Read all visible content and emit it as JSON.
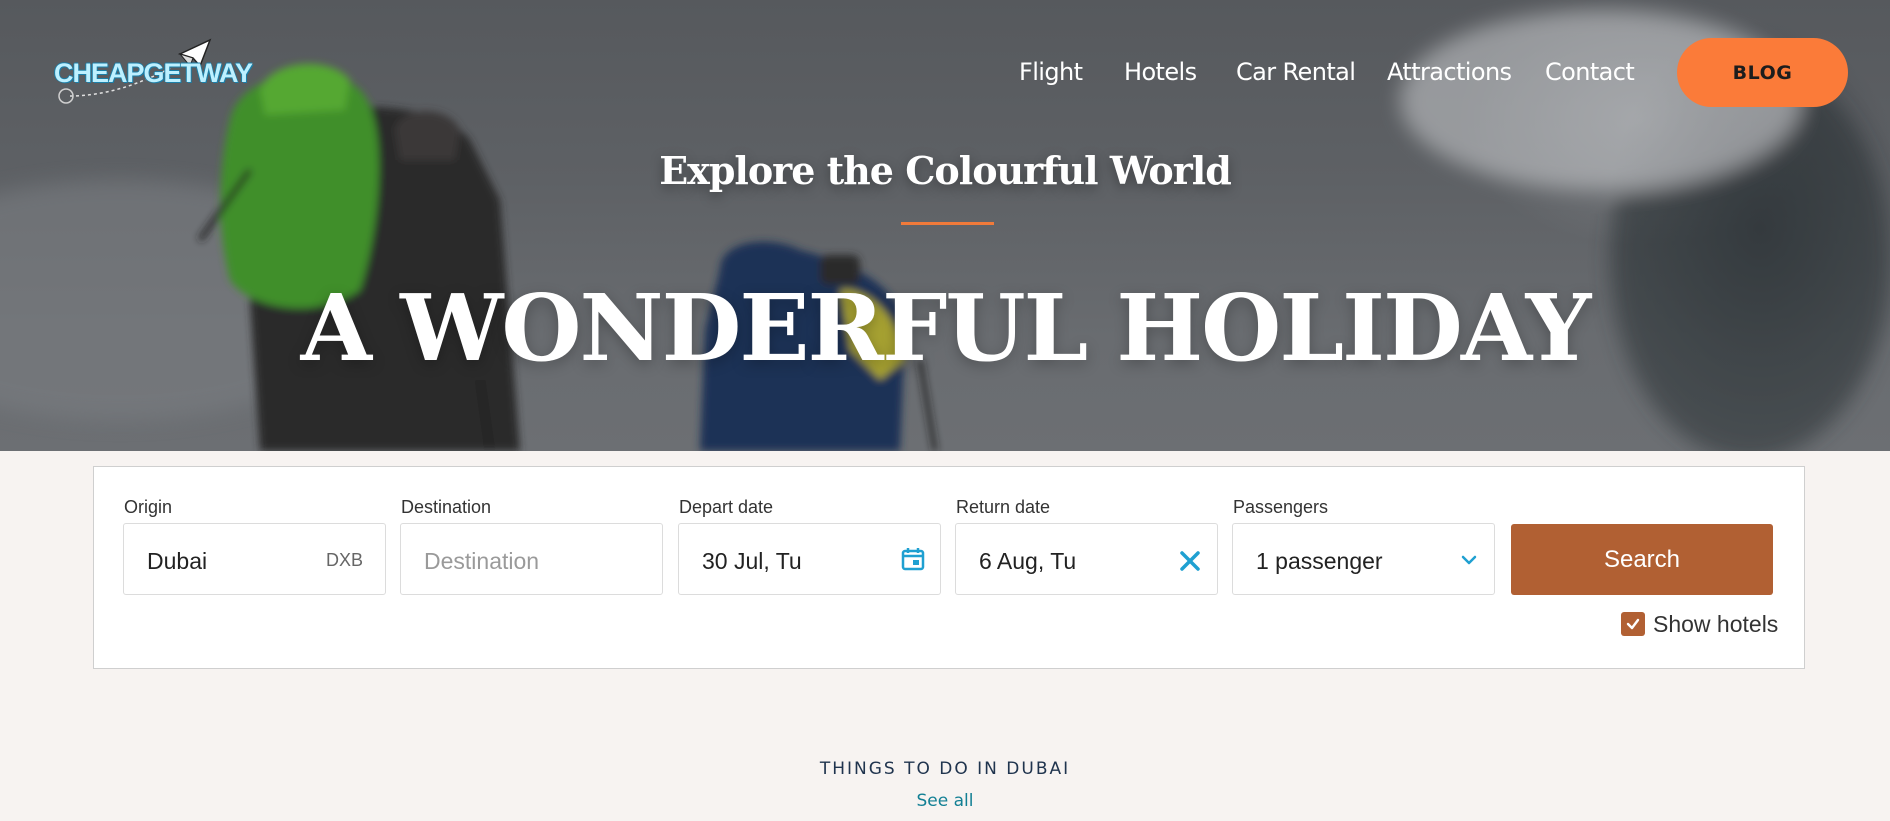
{
  "brand": {
    "logo_text": "CHEAPGETWAY"
  },
  "nav": {
    "items": [
      {
        "label": "Flight"
      },
      {
        "label": "Hotels"
      },
      {
        "label": "Car Rental"
      },
      {
        "label": "Attractions"
      },
      {
        "label": "Contact"
      }
    ],
    "blog_label": "BLOG"
  },
  "hero": {
    "subtitle": "Explore the Colourful World",
    "title": "A WONDERFUL HOLIDAY"
  },
  "search": {
    "origin": {
      "label": "Origin",
      "value": "Dubai",
      "code": "DXB"
    },
    "destination": {
      "label": "Destination",
      "placeholder": "Destination",
      "value": ""
    },
    "depart": {
      "label": "Depart date",
      "value": "30 Jul, Tu",
      "icon": "calendar-icon"
    },
    "return": {
      "label": "Return date",
      "value": "6 Aug, Tu",
      "icon": "clear-x-icon"
    },
    "passengers": {
      "label": "Passengers",
      "value": "1 passenger",
      "icon": "chevron-down-icon"
    },
    "search_label": "Search",
    "show_hotels": {
      "label": "Show hotels",
      "checked": true
    }
  },
  "things": {
    "title": "THINGS TO DO IN DUBAI",
    "see_all": "See all"
  },
  "colors": {
    "accent_orange": "#fb7b39",
    "search_button": "#b16033",
    "icon_blue": "#1fa0d1",
    "link_teal": "#127f94"
  }
}
